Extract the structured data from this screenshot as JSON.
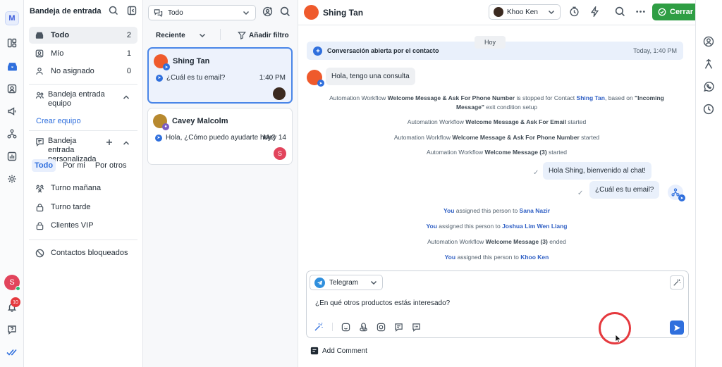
{
  "rail": {
    "logo": "M",
    "items": [
      {
        "icon": "layout-icon"
      },
      {
        "icon": "inbox-icon"
      },
      {
        "icon": "contacts-icon"
      },
      {
        "icon": "megaphone-icon"
      },
      {
        "icon": "workflow-icon"
      },
      {
        "icon": "reports-icon"
      },
      {
        "icon": "settings-icon"
      }
    ],
    "avatar_initial": "S",
    "notification_count": "10"
  },
  "inbox": {
    "title": "Bandeja de entrada",
    "items": [
      {
        "label": "Todo",
        "count": "2"
      },
      {
        "label": "Mío",
        "count": "1"
      },
      {
        "label": "No asignado",
        "count": "0"
      }
    ],
    "team_section": "Bandeja entrada equipo",
    "create_team": "Crear equipo",
    "custom_section": "Bandeja entrada personalizada",
    "custom_tabs": [
      "Todo",
      "Por mi",
      "Por otros"
    ],
    "custom_items": [
      {
        "label": "Turno mañana"
      },
      {
        "label": "Turno tarde"
      },
      {
        "label": "Clientes VIP"
      }
    ],
    "blocked": "Contactos bloqueados"
  },
  "list": {
    "filter": "Todo",
    "sort": "Reciente",
    "add_filter": "Añadir filtro",
    "conversations": [
      {
        "name": "Shing Tan",
        "message": "¿Cuál es tu email?",
        "time": "1:40 PM"
      },
      {
        "name": "Cavey Malcolm",
        "message": "Hola, ¿Cómo puedo ayudarte hoy?",
        "time": "May 14",
        "assignee": "S"
      }
    ]
  },
  "chat": {
    "contact": "Shing Tan",
    "assignee": "Khoo Ken",
    "close_label": "Cerrar",
    "day": "Hoy",
    "banner": {
      "text": "Conversación abierta por el contacto",
      "time": "Today, 1:40 PM"
    },
    "incoming": "Hola, tengo una consulta",
    "sys1": {
      "p1": "Automation Workflow ",
      "b1": "Welcome Message & Ask For Phone Number",
      "p2": " is stopped for Contact ",
      "contact": "Shing Tan",
      "p3": ", based on ",
      "b2": "\"Incoming",
      "b3": "Message\"",
      "p4": " exit condition setup"
    },
    "sys2": {
      "p1": "Automation Workflow ",
      "b1": "Welcome Message & Ask For Email",
      "p2": " started"
    },
    "sys3": {
      "p1": "Automation Workflow ",
      "b1": "Welcome Message & Ask For Phone Number",
      "p2": " started"
    },
    "sys4": {
      "p1": "Automation Workflow ",
      "b1": "Welcome Message (3)",
      "p2": " started"
    },
    "out1": "Hola Shing, bienvenido al chat!",
    "out2": "¿Cuál es tu email?",
    "assign1": {
      "you": "You",
      "mid": " assigned this person to ",
      "name": "Sana Nazir"
    },
    "assign2": {
      "you": "You",
      "mid": " assigned this person to ",
      "name": "Joshua Lim Wen Liang"
    },
    "sys5": {
      "p1": "Automation Workflow ",
      "b1": "Welcome Message (3)",
      "p2": " ended"
    },
    "assign3": {
      "you": "You",
      "mid": " assigned this person to ",
      "name": "Khoo Ken"
    },
    "composer": {
      "channel": "Telegram",
      "draft": "¿En qué otros productos estás interesado?"
    },
    "add_comment": "Add Comment"
  },
  "colors": {
    "accent": "#2f6fdd",
    "close_button": "#2f9e44",
    "highlight": "#e5393e"
  }
}
